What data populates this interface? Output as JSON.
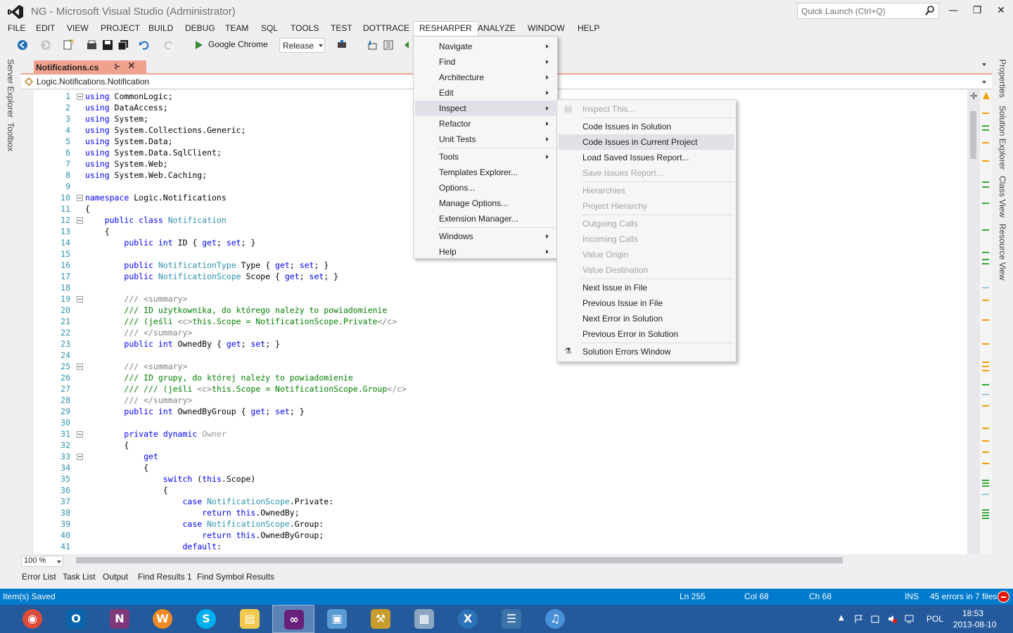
{
  "window": {
    "title": "NG - Microsoft Visual Studio (Administrator)",
    "quick_launch_placeholder": "Quick Launch (Ctrl+Q)",
    "minimize_icon": "minimize-icon",
    "maximize_icon": "restore-icon",
    "close_icon": "close-icon"
  },
  "menubar": [
    "FILE",
    "EDIT",
    "VIEW",
    "PROJECT",
    "BUILD",
    "DEBUG",
    "TEAM",
    "SQL",
    "TOOLS",
    "TEST",
    "DOTTRACE",
    "RESHARPER",
    "ANALYZE",
    "WINDOW",
    "HELP"
  ],
  "toolbar": {
    "run_target": "Google Chrome",
    "configuration": "Release"
  },
  "side_tabs": {
    "left": [
      "Server Explorer",
      "Toolbox"
    ],
    "right": [
      "Properties",
      "Solution Explorer",
      "Class View",
      "Resource View"
    ]
  },
  "document": {
    "tab_label": "Notifications.cs",
    "tab_color": "#f0a28f",
    "nav_path": "Logic.Notifications.Notification"
  },
  "editor": {
    "line_numbers": [
      "1",
      "2",
      "3",
      "4",
      "5",
      "6",
      "7",
      "8",
      "9",
      "10",
      "11",
      "12",
      "13",
      "14",
      "15",
      "16",
      "17",
      "18",
      "19",
      "20",
      "21",
      "22",
      "23",
      "24",
      "25",
      "26",
      "27",
      "28",
      "29",
      "30",
      "31",
      "32",
      "33",
      "34",
      "35",
      "36",
      "37",
      "38",
      "39",
      "40",
      "41"
    ],
    "zoom": "100 %"
  },
  "resharper_menu": {
    "items": [
      {
        "label": "Navigate",
        "submenu": true
      },
      {
        "label": "Find",
        "submenu": true
      },
      {
        "label": "Architecture",
        "submenu": true
      },
      {
        "label": "Edit",
        "submenu": true
      },
      {
        "label": "Inspect",
        "submenu": true,
        "highlighted": true
      },
      {
        "label": "Refactor",
        "submenu": true
      },
      {
        "label": "Unit Tests",
        "submenu": true
      },
      {
        "label": "Tools",
        "submenu": true
      },
      {
        "label": "Templates Explorer...",
        "submenu": false
      },
      {
        "label": "Options...",
        "submenu": false
      },
      {
        "label": "Manage Options...",
        "submenu": false
      },
      {
        "label": "Extension Manager...",
        "submenu": false
      },
      {
        "label": "Windows",
        "submenu": true
      },
      {
        "label": "Help",
        "submenu": true
      }
    ]
  },
  "inspect_menu": {
    "items": [
      {
        "label": "Inspect This...",
        "enabled": false
      },
      {
        "label": "Code Issues in Solution",
        "enabled": true
      },
      {
        "label": "Code Issues in Current Project",
        "enabled": true,
        "highlighted": true
      },
      {
        "label": "Load Saved Issues Report...",
        "enabled": true
      },
      {
        "label": "Save Issues Report...",
        "enabled": false
      },
      {
        "label": "Hierarchies",
        "enabled": false
      },
      {
        "label": "Project Hierarchy",
        "enabled": false
      },
      {
        "label": "Outgoing Calls",
        "enabled": false
      },
      {
        "label": "Incoming Calls",
        "enabled": false
      },
      {
        "label": "Value Origin",
        "enabled": false
      },
      {
        "label": "Value Destination",
        "enabled": false
      },
      {
        "label": "Next Issue in File",
        "enabled": true
      },
      {
        "label": "Previous Issue in File",
        "enabled": true
      },
      {
        "label": "Next Error in Solution",
        "enabled": true
      },
      {
        "label": "Previous Error in Solution",
        "enabled": true
      },
      {
        "label": "Solution Errors Window",
        "enabled": true
      }
    ]
  },
  "tool_tabs": [
    "Error List",
    "Task List",
    "Output",
    "Find Results 1",
    "Find Symbol Results"
  ],
  "statusbar": {
    "message": "Item(s) Saved",
    "line": "Ln 255",
    "col": "Col 68",
    "ch": "Ch 68",
    "mode": "INS",
    "errors": "45 errors in 7 files",
    "color": "#007acc"
  },
  "taskbar": {
    "apps": [
      "chrome-icon",
      "outlook-icon",
      "onenote-icon",
      "winamp-icon",
      "skype-icon",
      "file-explorer-icon",
      "visual-studio-icon",
      "remote-desktop-icon",
      "tools-icon",
      "network-icon",
      "xamarin-icon",
      "python-icon",
      "itunes-icon"
    ],
    "language": "POL",
    "time": "18:53",
    "date": "2013-08-10"
  }
}
